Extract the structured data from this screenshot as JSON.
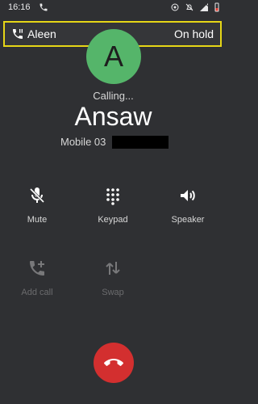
{
  "status_bar": {
    "time": "16:16",
    "icons": [
      "phone-icon",
      "focus-icon",
      "bell-off-icon",
      "signal-icon",
      "battery-icon"
    ]
  },
  "hold_banner": {
    "name": "Aleen",
    "status": "On hold",
    "border_color": "#e6d617"
  },
  "caller": {
    "avatar_letter": "A",
    "avatar_color": "#55b56a",
    "status": "Calling...",
    "name": "Ansaw",
    "number_label": "Mobile 03"
  },
  "controls": {
    "mute": "Mute",
    "keypad": "Keypad",
    "speaker": "Speaker",
    "add_call": "Add call",
    "swap": "Swap"
  },
  "end_call": {
    "color": "#d32f2f"
  }
}
